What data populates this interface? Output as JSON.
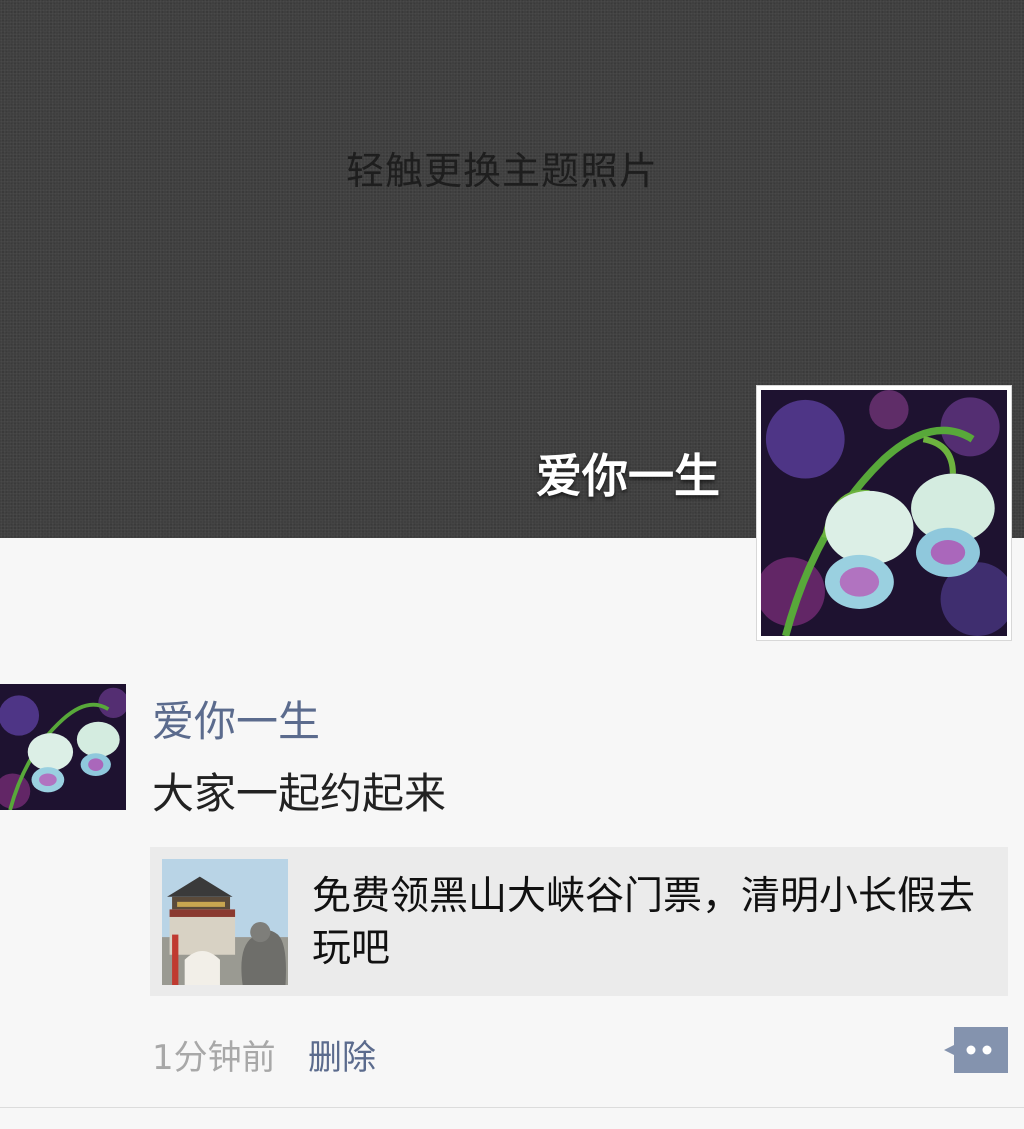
{
  "cover": {
    "hint": "轻触更换主题照片",
    "owner_name": "爱你一生",
    "owner_avatar_icon": "lily-of-the-valley-photo"
  },
  "post": {
    "author": "爱你一生",
    "avatar_icon": "lily-of-the-valley-photo",
    "text": "大家一起约起来",
    "link": {
      "title": "免费领黑山大峡谷门票，清明小长假去玩吧",
      "thumbnail_icon": "chinese-gate-photo"
    },
    "time": "1分钟前",
    "delete_label": "删除",
    "more_icon": "comment-more-icon"
  },
  "colors": {
    "link_blue": "#5b6b8d",
    "cover_bg": "#3f3f3f",
    "page_bg": "#f7f7f7",
    "card_bg": "#ebebeb"
  }
}
